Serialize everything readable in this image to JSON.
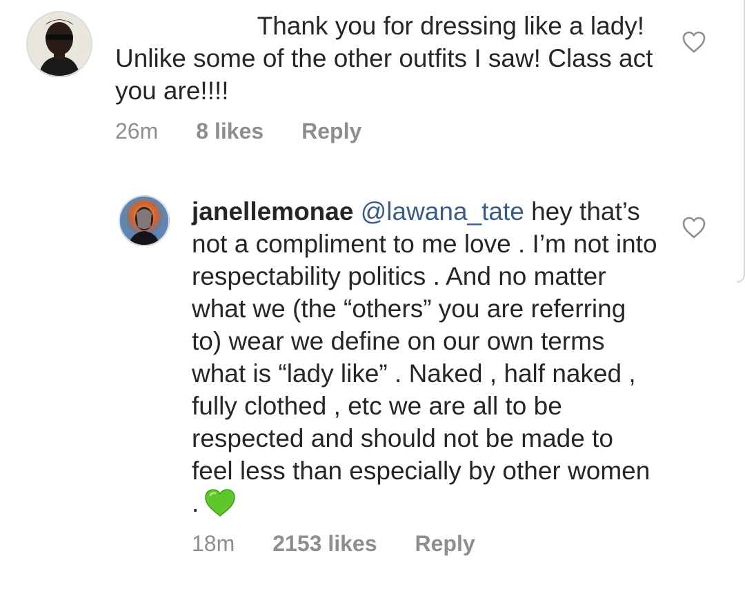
{
  "comments": [
    {
      "text": "                    Thank you for dressing like a lady! Unlike some of the other outfits I saw! Class act you are!!!!",
      "time": "26m",
      "likes": "8 likes",
      "reply": "Reply"
    }
  ],
  "replies": [
    {
      "username": "janellemonae",
      "mention": "@lawana_tate",
      "text": " hey that’s not a compliment to me love . I’m not into respectability politics . And no matter what we (the “others” you are referring to) wear we define on our own terms what is “lady like” . Naked , half naked , fully clothed , etc we are all to be respected and should not be made to feel less than especially by other women .",
      "emoji": "green-heart",
      "time": "18m",
      "likes": "2153 likes",
      "reply": "Reply"
    }
  ],
  "icons": {
    "like": "heart-outline-icon",
    "emoji_color": "#5ec82b"
  }
}
